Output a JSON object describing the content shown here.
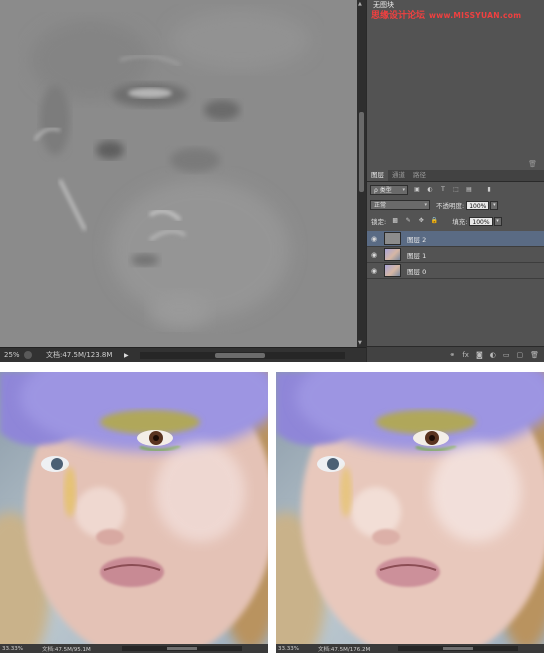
{
  "workspace": {
    "status": {
      "zoom": "25%",
      "doc": "文档:47.5M/123.8M"
    },
    "upper_panel": {
      "tab": "无图块"
    },
    "watermark": {
      "text": "思缘设计论坛",
      "url": "www.MISSYUAN.com"
    },
    "layers_panel": {
      "tabs": [
        {
          "label": "图层",
          "active": true
        },
        {
          "label": "通道",
          "active": false
        },
        {
          "label": "路径",
          "active": false
        }
      ],
      "filter": {
        "label": "类型"
      },
      "blend_mode": "正常",
      "opacity": {
        "label": "不透明度:",
        "value": "100%"
      },
      "lock": {
        "label": "锁定:"
      },
      "fill": {
        "label": "填充:",
        "value": "100%"
      },
      "layers": [
        {
          "name": "图层 2",
          "selected": true,
          "thumb": "gray"
        },
        {
          "name": "图层 1",
          "selected": false,
          "thumb": "photo"
        },
        {
          "name": "图层 0",
          "selected": false,
          "thumb": "photo"
        }
      ]
    }
  },
  "comparison": {
    "left": {
      "zoom": "33.33%",
      "doc": "文档:47.5M/95.1M"
    },
    "right": {
      "zoom": "33.33%",
      "doc": "文档:47.5M/176.2M"
    }
  },
  "colors": {
    "selected_layer": "#5a6b84",
    "watermark": "#f04040",
    "panel": "#535353"
  }
}
